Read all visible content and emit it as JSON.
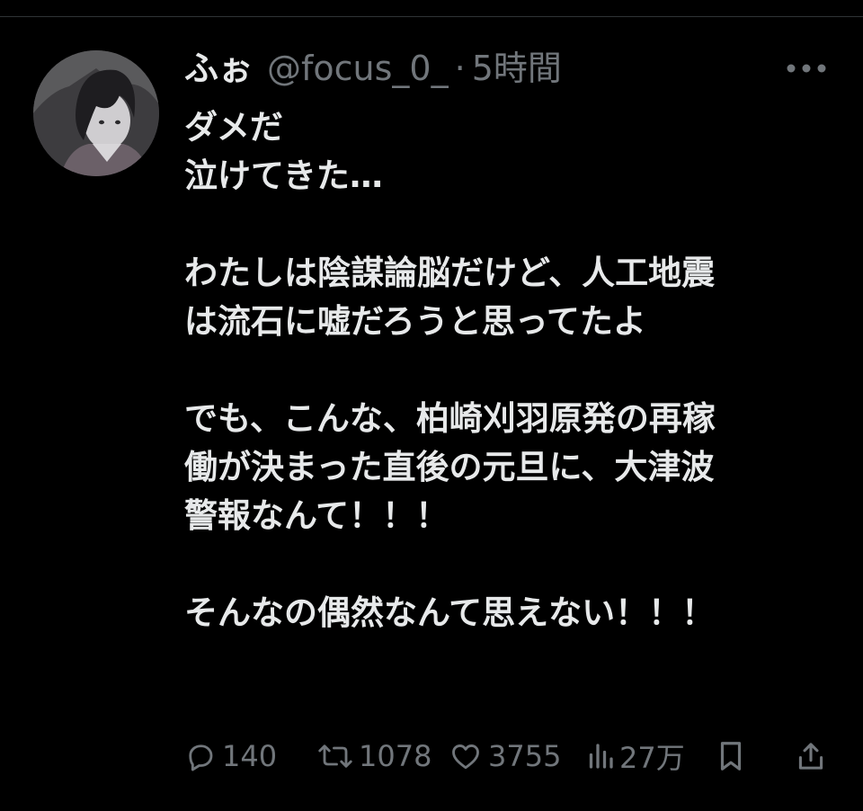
{
  "post": {
    "author": {
      "display_name": "ふぉ",
      "handle": "@focus_0_",
      "avatar_icon": "anime-character-avatar"
    },
    "separator": "·",
    "timestamp": "5時間",
    "more_icon": "more-icon",
    "text_lines": [
      "ダメだ",
      "泣けてきた…",
      "",
      "わたしは陰謀論脳だけど、人工地震",
      "は流石に嘘だろうと思ってたよ",
      "",
      "でも、こんな、柏崎刈羽原発の再稼",
      "働が決まった直後の元旦に、大津波",
      "警報なんて！！！",
      "",
      "そんなの偶然なんて思えない！！！"
    ],
    "actions": {
      "reply": {
        "icon": "reply-icon",
        "count": "140"
      },
      "repost": {
        "icon": "repost-icon",
        "count": "1078"
      },
      "like": {
        "icon": "like-icon",
        "count": "3755"
      },
      "views": {
        "icon": "views-icon",
        "count": "27万"
      },
      "bookmark": {
        "icon": "bookmark-icon"
      },
      "share": {
        "icon": "share-icon"
      }
    }
  },
  "colors": {
    "background": "#000000",
    "text": "#e7e9ea",
    "secondary": "#71767b",
    "divider": "#2f3336"
  }
}
